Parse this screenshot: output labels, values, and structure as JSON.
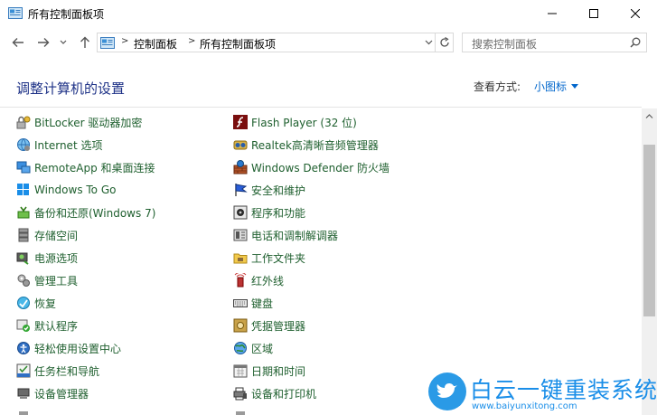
{
  "window": {
    "title": "所有控制面板项"
  },
  "nav": {
    "breadcrumb": [
      "控制面板",
      "所有控制面板项"
    ],
    "search_placeholder": "搜索控制面板"
  },
  "header": {
    "title": "调整计算机的设置",
    "view_by_label": "查看方式:",
    "view_mode": "小图标"
  },
  "items_left": [
    {
      "label": "BitLocker 驱动器加密",
      "icon": "bitlocker-icon"
    },
    {
      "label": "Internet 选项",
      "icon": "internet-options-icon"
    },
    {
      "label": "RemoteApp 和桌面连接",
      "icon": "remoteapp-icon"
    },
    {
      "label": "Windows To Go",
      "icon": "windows-to-go-icon"
    },
    {
      "label": "备份和还原(Windows 7)",
      "icon": "backup-restore-icon"
    },
    {
      "label": "存储空间",
      "icon": "storage-spaces-icon"
    },
    {
      "label": "电源选项",
      "icon": "power-options-icon"
    },
    {
      "label": "管理工具",
      "icon": "admin-tools-icon"
    },
    {
      "label": "恢复",
      "icon": "recovery-icon"
    },
    {
      "label": "默认程序",
      "icon": "default-programs-icon"
    },
    {
      "label": "轻松使用设置中心",
      "icon": "ease-of-access-icon"
    },
    {
      "label": "任务栏和导航",
      "icon": "taskbar-icon"
    },
    {
      "label": "设备管理器",
      "icon": "device-manager-icon"
    }
  ],
  "items_right": [
    {
      "label": "Flash Player (32 位)",
      "icon": "flash-player-icon"
    },
    {
      "label": "Realtek高清晰音频管理器",
      "icon": "realtek-audio-icon"
    },
    {
      "label": "Windows Defender 防火墙",
      "icon": "firewall-icon"
    },
    {
      "label": "安全和维护",
      "icon": "security-maintenance-icon"
    },
    {
      "label": "程序和功能",
      "icon": "programs-features-icon"
    },
    {
      "label": "电话和调制解调器",
      "icon": "phone-modem-icon"
    },
    {
      "label": "工作文件夹",
      "icon": "work-folders-icon"
    },
    {
      "label": "红外线",
      "icon": "infrared-icon"
    },
    {
      "label": "键盘",
      "icon": "keyboard-icon"
    },
    {
      "label": "凭据管理器",
      "icon": "credential-manager-icon"
    },
    {
      "label": "区域",
      "icon": "region-icon"
    },
    {
      "label": "日期和时间",
      "icon": "date-time-icon"
    },
    {
      "label": "设备和打印机",
      "icon": "devices-printers-icon"
    }
  ],
  "watermark": {
    "text": "白云一键重装系统",
    "url": "www.baiyunxitong.com"
  },
  "colors": {
    "link": "#1e5f2e",
    "title": "#1e3287",
    "accent": "#0066cc"
  }
}
